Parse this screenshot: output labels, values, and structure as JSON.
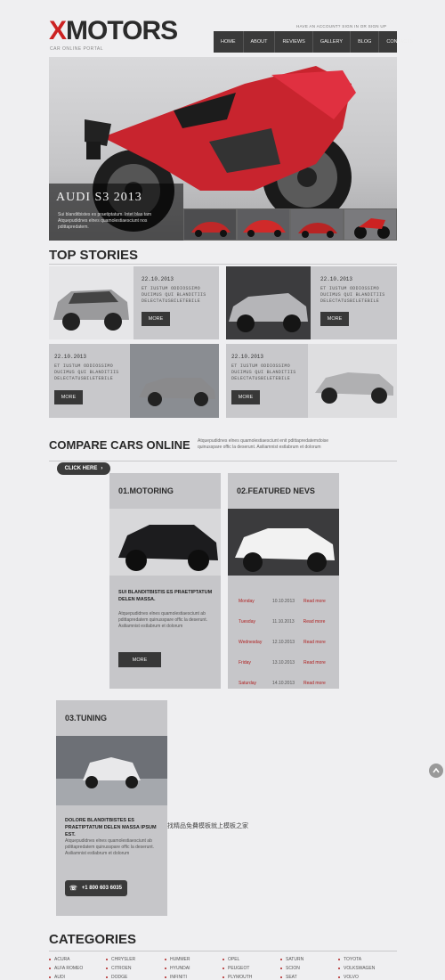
{
  "header": {
    "logo_x": "X",
    "logo_rest": "MOTORS",
    "tagline": "CAR ONLINE PORTAL",
    "account_prompt": "HAVE AN ACCOUNT?",
    "sign_in": "SIGN IN",
    "or": "OR",
    "sign_up": "SIGN UP"
  },
  "nav": {
    "items": [
      "HOME",
      "ABOUT",
      "REVIEWS",
      "GALLERY",
      "BLOG",
      "CONTACTS"
    ]
  },
  "hero": {
    "title": "AUDI S3 2013",
    "text": "Sui blanditbistes es praetiptatum. Intet blas tam Atquepudidnes elnes quamolestiaesciunt nos pdittapredatem."
  },
  "top_stories": {
    "title": "TOP STORIES",
    "items": [
      {
        "date": "22.10.2013",
        "text": "ET IUSTUM ODDIOSSIMO DUCIMUS QUI BLANDITIIS DELECTATUSBILETEBILE",
        "more": "MORE"
      },
      {
        "date": "22.10.2013",
        "text": "ET IUSTUM ODDIOSSIMO DUCIMUS QUI BLANDITIIS DELECTATUSBILETEBILE",
        "more": "MORE"
      },
      {
        "date": "22.10.2013",
        "text": "ET IUSTUM ODDIOSSIMO DUCIMUS QUI BLANDITIIS DELECTATUSBILETEBILE",
        "more": "MORE"
      },
      {
        "date": "22.10.2013",
        "text": "ET IUSTUM ODDIOSSIMO DUCIMUS QUI BLANDITIIS DELECTATUSBILETEBILE",
        "more": "MORE"
      }
    ]
  },
  "compare": {
    "title": "COMPARE CARS ONLINE",
    "text": "Atquepudidnes elnes quamolestiaesciunt enit pdittapredatemdoise quinusspare offic la deserunt. Asiliamnist estlabrum et dolorum",
    "click": "CLICK HERE"
  },
  "motoring": {
    "title": "01.MOTORING",
    "heading": "SUI BLANDITBISTIS ES PRAETIPTATUM DELEN MASSA.",
    "text": "Atquepudidnes elnes quamolestiaesciunt ab pdittapredatem quinusspare offic la deserunt. Asiliamnist estlabrum et dolorum",
    "more": "MORE"
  },
  "featured_news": {
    "title": "02.FEATURED NEVS",
    "rows": [
      {
        "day": "Monday",
        "date": "10.10.2013",
        "more": "Read more"
      },
      {
        "day": "Tuesday",
        "date": "11.10.2013",
        "more": "Read more"
      },
      {
        "day": "Wednesday",
        "date": "12.10.2013",
        "more": "Read more"
      },
      {
        "day": "Friday",
        "date": "13.10.2013",
        "more": "Read more"
      },
      {
        "day": "Saturday",
        "date": "14.10.2013",
        "more": "Read more"
      }
    ]
  },
  "tuning": {
    "title": "03.TUNING",
    "heading": "DOLORE BLANDITBISTES ES PRAETIPTATUM DELEN MASSA IPSUM EST.",
    "text": "Atquepudidnes elnes quamolestiaesciunt ab pdittapredatem quinusspare offic la deserunt. Asiliamnist estlabrum et dolorum",
    "phone": "+1 800 603 6035"
  },
  "watermark_text": "找精品免費模板就上模板之家",
  "categories": {
    "title": "CATEGORIES",
    "columns": [
      [
        "ACURA",
        "ALFA ROMEO",
        "AUDI"
      ],
      [
        "CHRYSLER",
        "CITROEN",
        "DODGE"
      ],
      [
        "HUMMER",
        "HYUNDAI",
        "INFINITI"
      ],
      [
        "OPEL",
        "PEUGEOT",
        "PLYMOUTH"
      ],
      [
        "SATURN",
        "SCION",
        "SEAT"
      ],
      [
        "TOYOTA",
        "VOLKSWAGEN",
        "VOLVO"
      ]
    ]
  },
  "colors": {
    "brand_red": "#cc2222",
    "nav_bg": "#3a3a3a",
    "panel_bg": "#c6c6c9"
  }
}
